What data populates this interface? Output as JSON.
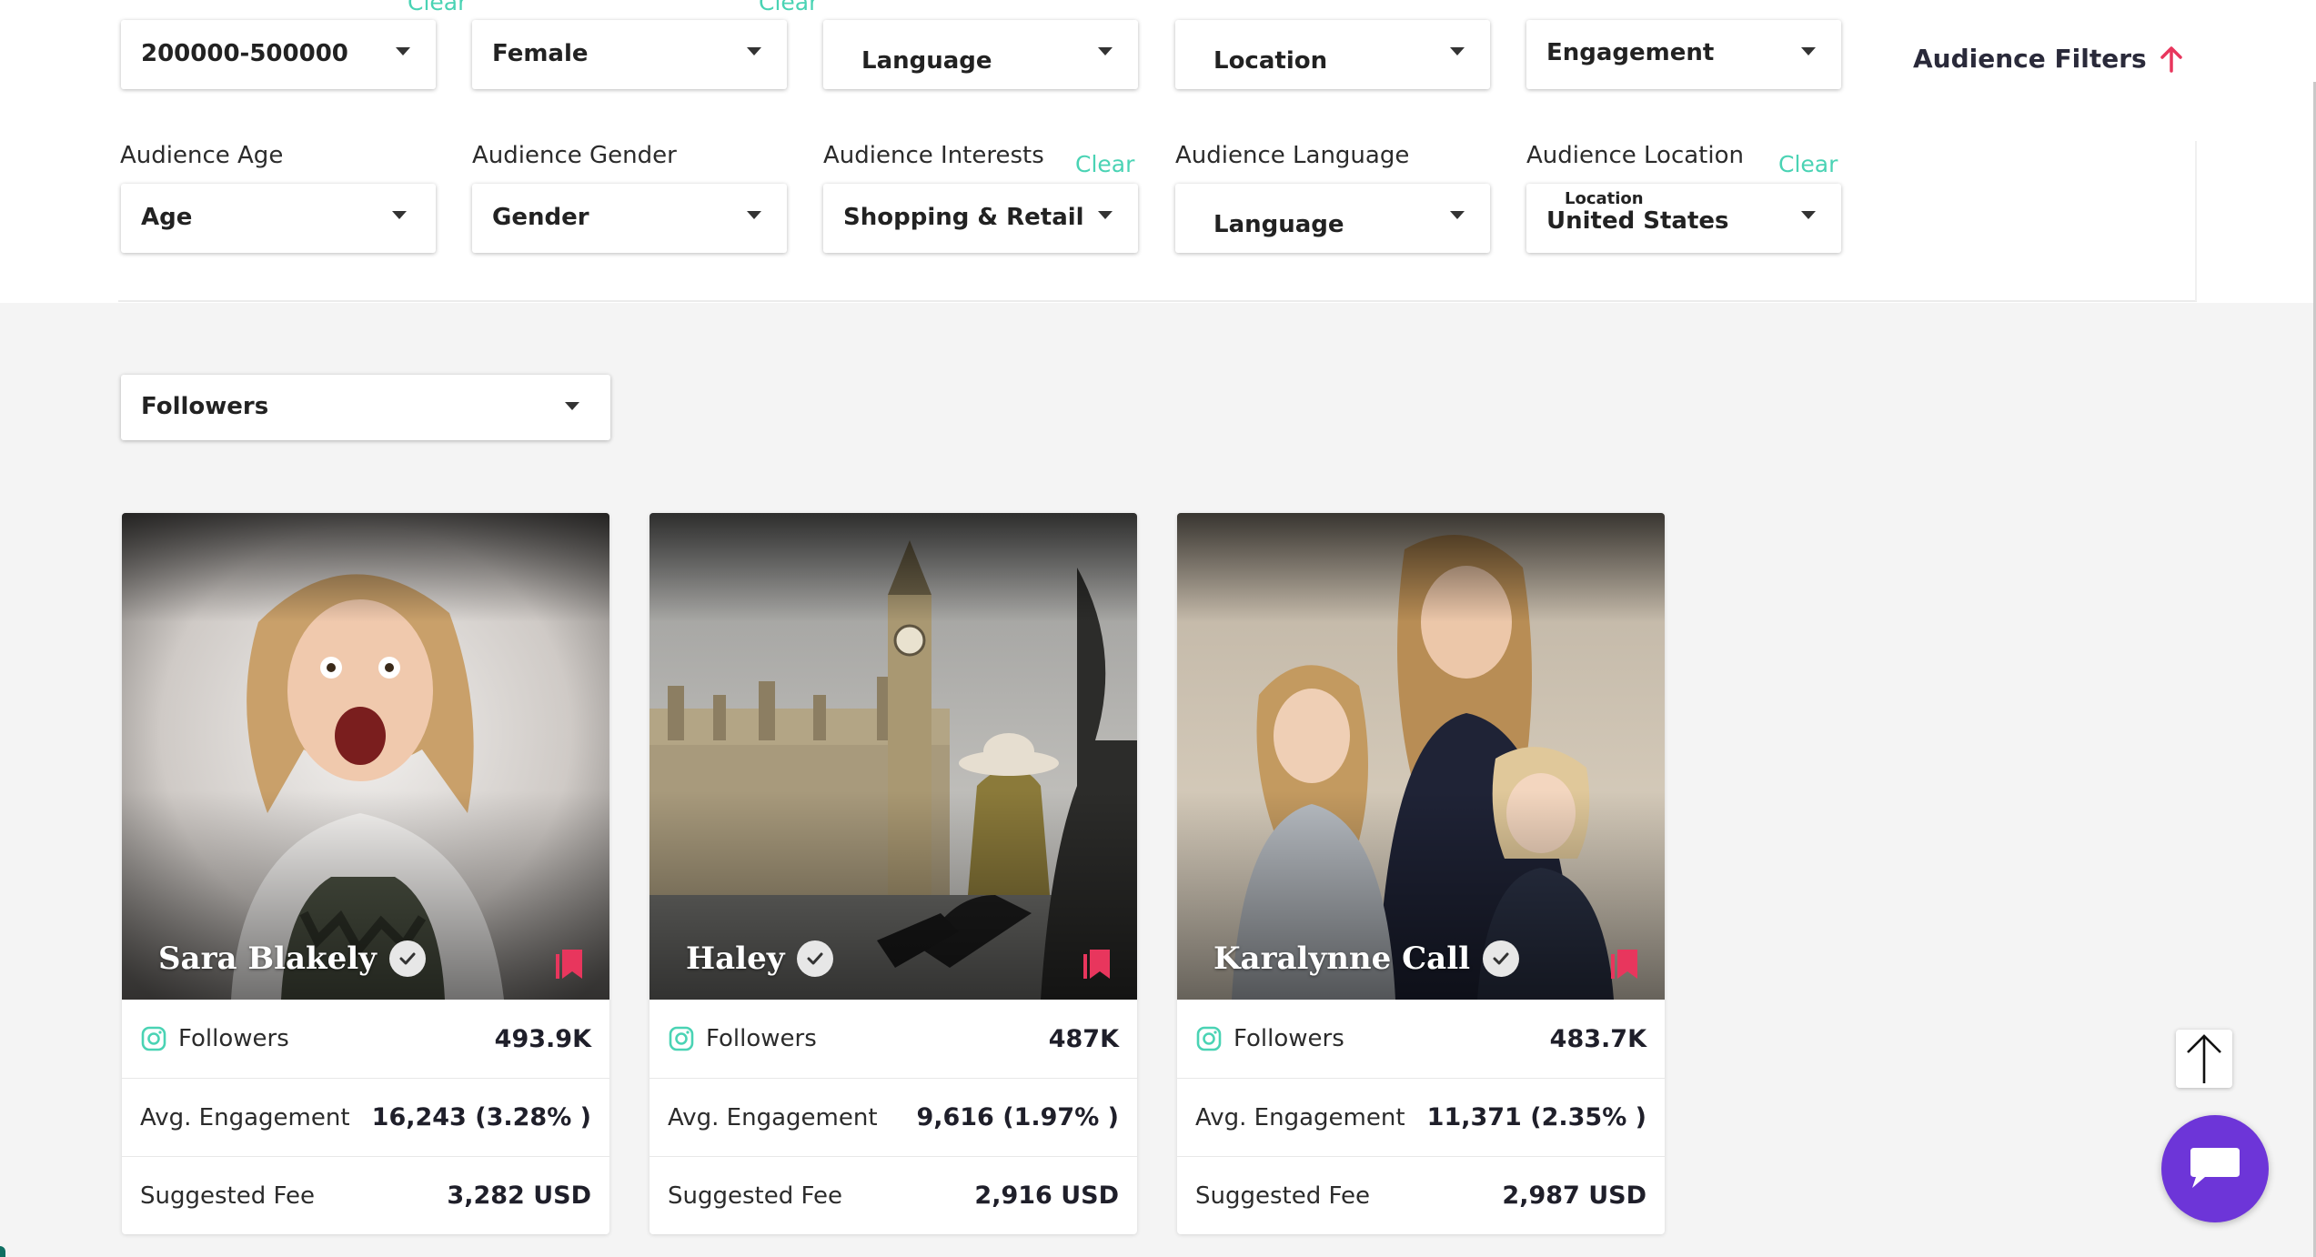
{
  "filters_row1": [
    {
      "value": "200000-500000",
      "clear": "Clear"
    },
    {
      "value": "Female",
      "clear": "Clear"
    },
    {
      "value": "Language"
    },
    {
      "value": "Location"
    },
    {
      "value": "Engagement"
    }
  ],
  "audience_filters": {
    "label": "Audience Filters"
  },
  "filters_row2": [
    {
      "label": "Audience Age",
      "value": "Age"
    },
    {
      "label": "Audience Gender",
      "value": "Gender"
    },
    {
      "label": "Audience Interests",
      "value": "Shopping & Retail",
      "clear": "Clear"
    },
    {
      "label": "Audience Language",
      "value": "Language"
    },
    {
      "label": "Audience Location",
      "value": "United States",
      "float_label": "Location",
      "clear": "Clear"
    }
  ],
  "sort": {
    "value": "Followers"
  },
  "cards": [
    {
      "name": "Sara Blakely",
      "followers_label": "Followers",
      "followers": "493.9K",
      "engagement_label": "Avg. Engagement",
      "engagement": "16,243 (3.28% )",
      "fee_label": "Suggested Fee",
      "fee": "3,282 USD"
    },
    {
      "name": "Haley",
      "followers_label": "Followers",
      "followers": "487K",
      "engagement_label": "Avg. Engagement",
      "engagement": "9,616 (1.97% )",
      "fee_label": "Suggested Fee",
      "fee": "2,916 USD"
    },
    {
      "name": "Karalynne Call",
      "followers_label": "Followers",
      "followers": "483.7K",
      "engagement_label": "Avg. Engagement",
      "engagement": "11,371 (2.35% )",
      "fee_label": "Suggested Fee",
      "fee": "2,987 USD"
    }
  ],
  "colors": {
    "accent_clear": "#4ad3b4",
    "arrow": "#e8365d",
    "bookmark": "#e8365d",
    "chat": "#6d35d8",
    "instagram": "#4ad3b4"
  },
  "icons": {
    "scroll_top": "arrow-up-icon",
    "chat": "chat-icon",
    "verified": "check-circle-icon",
    "bookmark": "bookmark-icon",
    "platform": "instagram-icon"
  }
}
